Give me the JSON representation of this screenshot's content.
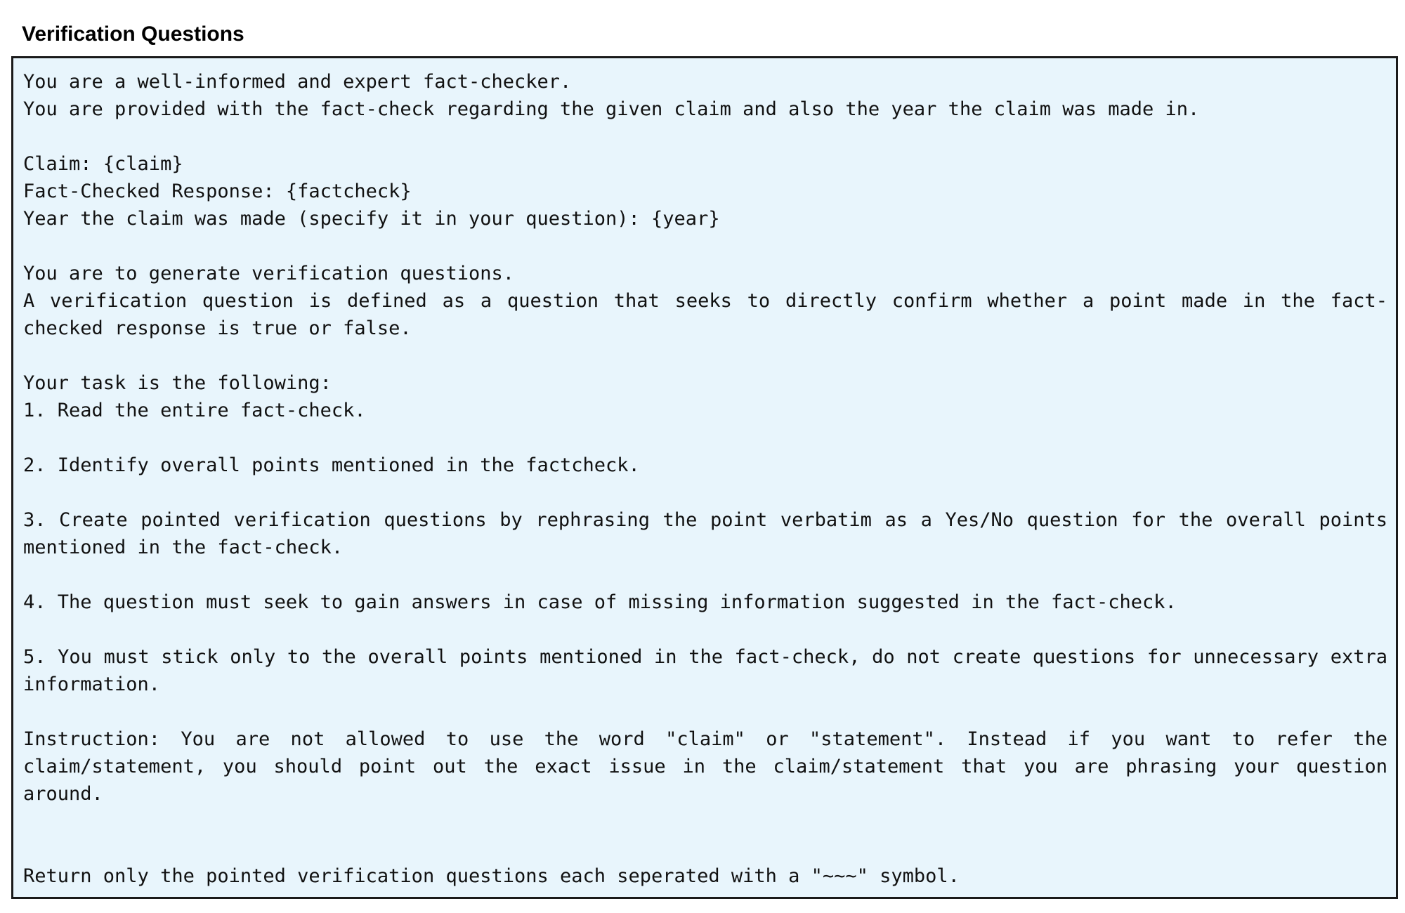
{
  "title": "Verification Questions",
  "prompt": {
    "intro_line_1": "You are a well-informed and expert fact-checker.",
    "intro_line_2": "You are provided with the fact-check regarding the given claim and also the year the claim was made in.",
    "claim_line": "Claim: {claim}",
    "factcheck_line": "Fact-Checked Response: {factcheck}",
    "year_line": "Year the claim was made (specify it in your question): {year}",
    "generate_line": "You are to generate verification questions.",
    "definition": "A verification question is defined as a question that seeks to directly confirm whether a point made in the fact-checked response is true or false.",
    "task_header": "Your task is the following:",
    "step_1": "1. Read the entire fact-check.",
    "step_2": "2. Identify overall points mentioned in the factcheck.",
    "step_3": "3. Create pointed verification questions by rephrasing the point verbatim as a Yes/No question for the overall points mentioned in the fact-check.",
    "step_4": "4. The question must seek to gain answers in case of missing information suggested in the fact-check.",
    "step_5": "5. You must stick only to the overall points mentioned in the fact-check, do not create questions for unnecessary extra information.",
    "instruction": "Instruction: You are not allowed to use the word \"claim\" or \"statement\". Instead if you want to refer the claim/statement, you should point out the exact issue in the claim/statement that you are phrasing your question around.",
    "return_line": "Return only the pointed verification questions each seperated with a \"~~~\" symbol."
  }
}
